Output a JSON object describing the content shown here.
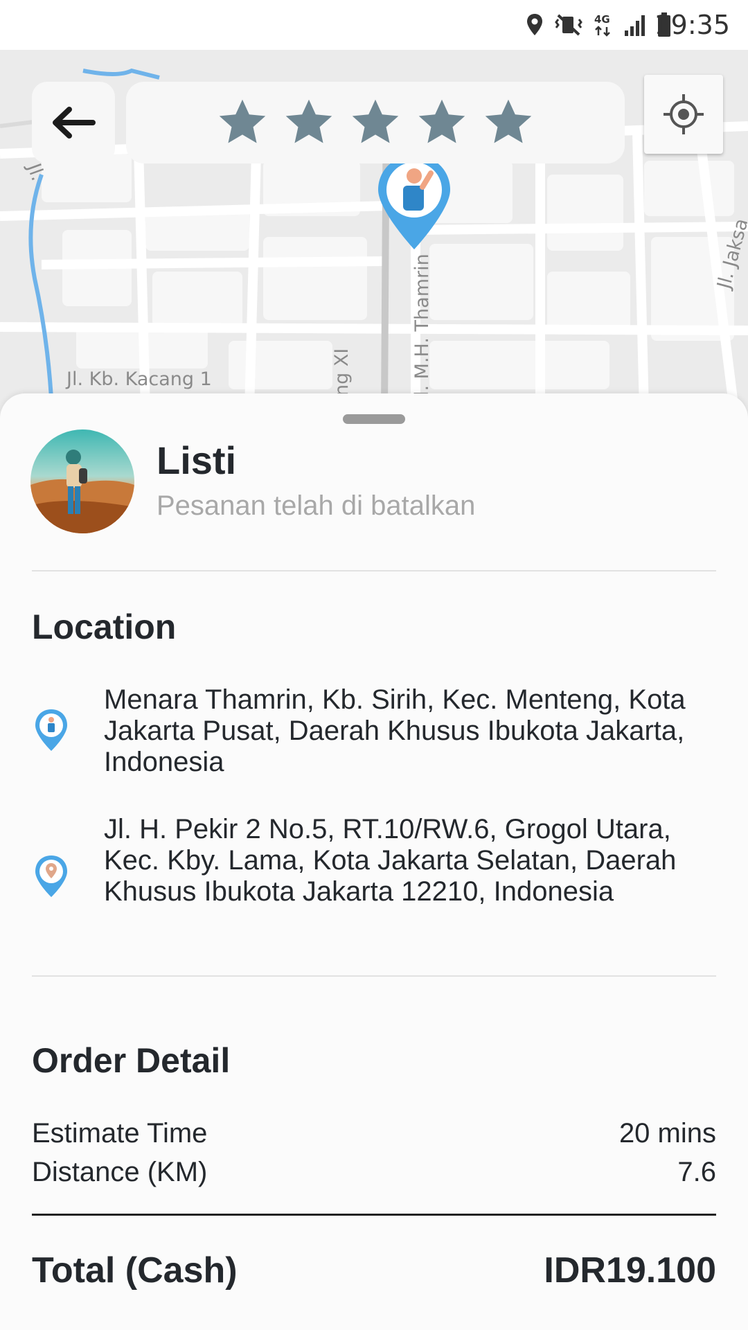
{
  "status_bar": {
    "time": "19:35",
    "network": "4G"
  },
  "map": {
    "labels": {
      "kb_kacang": "Jl. Kb. Kacang 1",
      "thamrin": "l. M.H. Thamrin",
      "jaksa": "Jl. Jaksa",
      "gang": "ng XI",
      "jl_left": "Jl."
    }
  },
  "rating": {
    "stars": 5,
    "max": 5,
    "star_color": "#6f8793"
  },
  "driver": {
    "name": "Listi",
    "status": "Pesanan telah di batalkan"
  },
  "location": {
    "title": "Location",
    "pickup": "Menara Thamrin, Kb. Sirih, Kec. Menteng, Kota Jakarta Pusat, Daerah Khusus Ibukota Jakarta, Indonesia",
    "dropoff": "Jl. H. Pekir 2 No.5, RT.10/RW.6, Grogol Utara, Kec. Kby. Lama, Kota Jakarta Selatan, Daerah Khusus Ibukota Jakarta 12210, Indonesia"
  },
  "order": {
    "title": "Order Detail",
    "estimate_label": "Estimate Time",
    "estimate_value": "20 mins",
    "distance_label": "Distance (KM)",
    "distance_value": "7.6",
    "total_label": "Total (Cash)",
    "total_value": "IDR19.100"
  },
  "colors": {
    "accent": "#4aa6e6",
    "text": "#24282d",
    "muted": "#a8a8a8"
  }
}
